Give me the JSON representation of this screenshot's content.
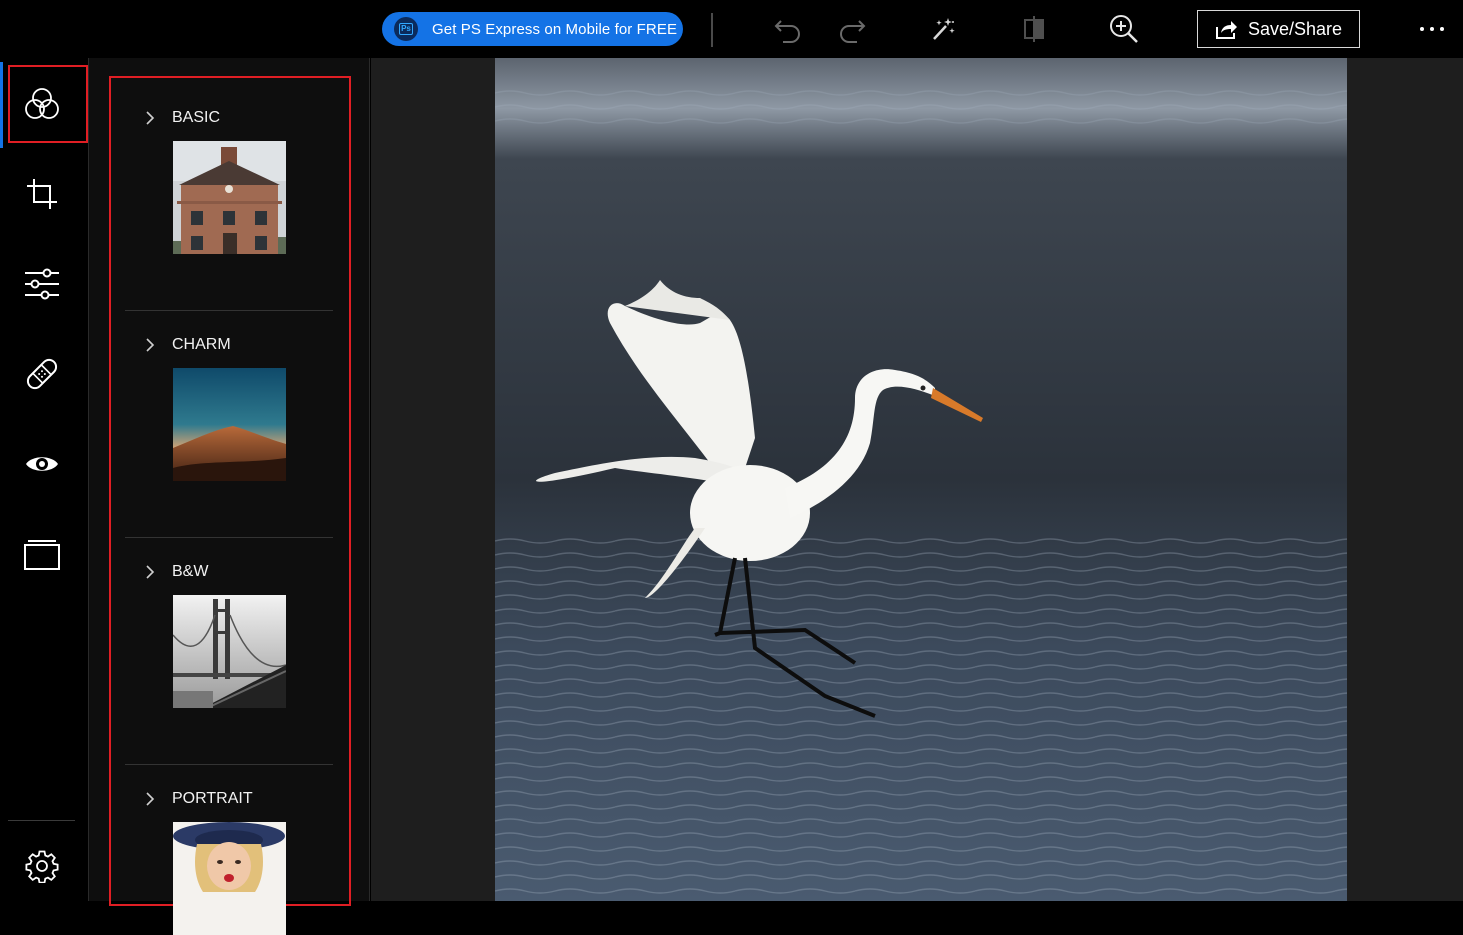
{
  "toolbar": {
    "promo_label": "Get PS Express on Mobile for FREE",
    "promo_badge": "Ps",
    "save_label": "Save/Share",
    "undo_icon": "undo-icon",
    "redo_icon": "redo-icon",
    "auto_fix_icon": "magic-wand-icon",
    "compare_icon": "compare-icon",
    "zoom_icon": "zoom-in-icon",
    "more_icon": "more-icon"
  },
  "rail": {
    "items": [
      {
        "icon": "looks-icon",
        "active": true
      },
      {
        "icon": "crop-icon"
      },
      {
        "icon": "adjustments-icon"
      },
      {
        "icon": "heal-bandage-icon"
      },
      {
        "icon": "eye-icon"
      },
      {
        "icon": "border-frame-icon"
      },
      {
        "icon": "settings-icon"
      }
    ]
  },
  "looks": {
    "sections": [
      {
        "name": "BASIC"
      },
      {
        "name": "CHARM"
      },
      {
        "name": "B&W"
      },
      {
        "name": "PORTRAIT"
      }
    ]
  },
  "colors": {
    "accent": "#1473e6",
    "highlight": "#e01e24",
    "background": "#000000",
    "canvas": "#1e1e1e"
  }
}
